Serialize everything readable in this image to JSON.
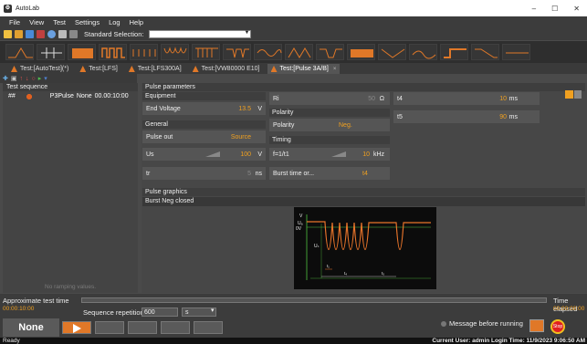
{
  "window": {
    "title": "AutoLab",
    "minimize": "–",
    "maximize": "☐",
    "close": "✕"
  },
  "menu": [
    "File",
    "View",
    "Test",
    "Settings",
    "Log",
    "Help"
  ],
  "toolbar": {
    "standard_selection_label": "Standard Selection:",
    "standard_selection_value": ""
  },
  "tabs": [
    {
      "label": "Test:[AutoTest](*)",
      "active": false
    },
    {
      "label": "Test:[LFS]",
      "active": false
    },
    {
      "label": "Test:[LFS300A]",
      "active": false
    },
    {
      "label": "Test:[VW80000 E10]",
      "active": false
    },
    {
      "label": "Test:[Pulse 3A/B]",
      "active": true,
      "close": "×"
    }
  ],
  "left_panel": {
    "title": "Test sequence",
    "row": {
      "index": "##",
      "name": "P3Pulse",
      "mode": "None",
      "time": "00.00:10:00"
    },
    "empty_text": "No ramping values."
  },
  "params": {
    "title": "Pulse parameters",
    "equipment": {
      "label": "Equipment",
      "end_voltage_label": "End Voltage",
      "end_voltage_value": "13.5",
      "end_voltage_unit": "V"
    },
    "general": {
      "label": "General",
      "pulse_out_label": "Pulse out",
      "pulse_out_value": "Source",
      "us_label": "Us",
      "us_value": "100",
      "us_unit": "V",
      "tr_label": "tr",
      "tr_value": "5",
      "tr_unit": "ns"
    },
    "ri": {
      "label": "Ri",
      "value": "50",
      "unit": "Ω"
    },
    "polarity": {
      "section": "Polarity",
      "label": "Polarity",
      "value": "Neg."
    },
    "timing": {
      "section": "Timing",
      "f_label": "f=1/t1",
      "f_value": "10",
      "f_unit": "kHz",
      "burst_label": "Burst time or...",
      "burst_value": "t4"
    },
    "t4": {
      "label": "t4",
      "value": "10",
      "unit": "ms"
    },
    "t5": {
      "label": "t5",
      "value": "90",
      "unit": "ms"
    }
  },
  "graphics": {
    "title": "Pulse graphics",
    "tab": "Burst Neg closed",
    "labels": {
      "v": "V",
      "u_top": "Uₐ",
      "zero": "0V",
      "us": "Uₛ",
      "t1": "t₁",
      "t4": "t₄",
      "t5": "t₅"
    }
  },
  "bottom": {
    "approx_label": "Approximate test time",
    "approx_value": "00:00:10:00",
    "seq_rep_label": "Sequence repetition",
    "seq_rep_value": "600",
    "seq_rep_unit": "s",
    "mode_button": "None",
    "message_before_running": "Message before running",
    "stop": "Stop",
    "time_elapsed_label": "Time elapsed",
    "time_elapsed_value": "00:00:00:00"
  },
  "status": {
    "left": "Ready",
    "right": "Current User: admin  Login Time: 11/9/2023 9:06:50 AM"
  },
  "colors": {
    "accent": "#f0a020",
    "orange": "#e07828",
    "scope_bg": "#0c0c0c",
    "wave": "#e8742a",
    "axis": "#50c040"
  }
}
